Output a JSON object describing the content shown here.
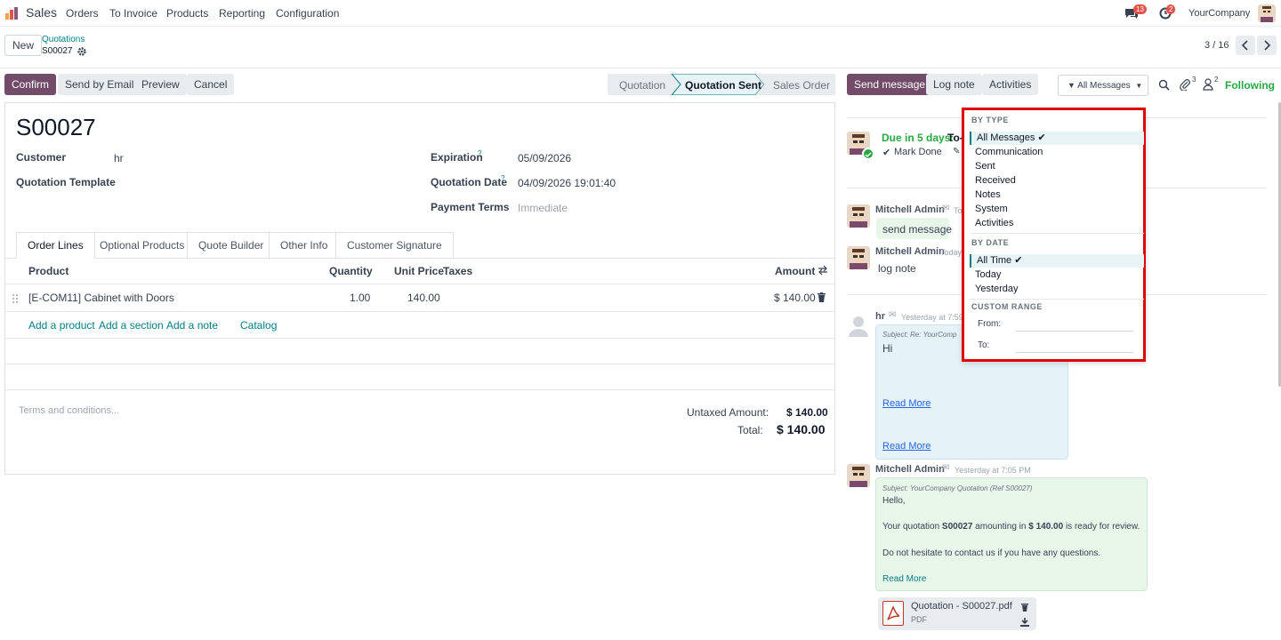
{
  "navbar": {
    "app_name": "Sales",
    "menu": [
      "Orders",
      "To Invoice",
      "Products",
      "Reporting",
      "Configuration"
    ],
    "chat_badge": "13",
    "activity_badge": "2",
    "company": "YourCompany"
  },
  "control": {
    "new_label": "New",
    "breadcrumb_parent": "Quotations",
    "record_name": "S00027",
    "pager": "3 / 16"
  },
  "actions": {
    "confirm": "Confirm",
    "send_email": "Send by Email",
    "preview": "Preview",
    "cancel": "Cancel"
  },
  "statusbar": [
    "Quotation",
    "Quotation Sent",
    "Sales Order"
  ],
  "chatter_actions": {
    "send_message": "Send message",
    "log_note": "Log note",
    "activities": "Activities",
    "filter": "All Messages",
    "attachments_count": "3",
    "followers_count": "2",
    "following": "Following"
  },
  "form": {
    "title": "S00027",
    "customer_label": "Customer",
    "customer_value": "hr",
    "template_label": "Quotation Template",
    "expiration_label": "Expiration",
    "expiration_value": "05/09/2026",
    "qdate_label": "Quotation Date",
    "qdate_value": "04/09/2026 19:01:40",
    "terms_label": "Payment Terms",
    "terms_value": "Immediate",
    "help_mark": "?"
  },
  "tabs": [
    "Order Lines",
    "Optional Products",
    "Quote Builder",
    "Other Info",
    "Customer Signature"
  ],
  "lines": {
    "headers": {
      "product": "Product",
      "quantity": "Quantity",
      "unit_price": "Unit Price",
      "taxes": "Taxes",
      "amount": "Amount"
    },
    "rows": [
      {
        "product": "[E-COM11] Cabinet with Doors",
        "quantity": "1.00",
        "unit_price": "140.00",
        "taxes": "",
        "amount": "$ 140.00"
      }
    ],
    "add_product": "Add a product",
    "add_section": "Add a section",
    "add_note": "Add a note",
    "catalog": "Catalog"
  },
  "totals": {
    "terms_placeholder": "Terms and conditions...",
    "untaxed_label": "Untaxed Amount:",
    "untaxed_value": "$ 140.00",
    "total_label": "Total:",
    "total_value": "$ 140.00"
  },
  "chatter": {
    "activity_due": "Due in 5 days:",
    "activity_type": "To-",
    "mark_done": "Mark Done",
    "msg1_author": "Mitchell Admin",
    "msg1_time": "To",
    "msg1_body": "send message",
    "msg2_author": "Mitchell Admin",
    "msg2_time": "Today",
    "msg2_body": "log note",
    "msg3_author": "hr",
    "msg3_time": "Yesterday at 7:59 P",
    "msg3_subject": "Subject: Re: YourComp",
    "msg3_body": "Hi",
    "read_more": "Read More",
    "msg4_author": "Mitchell Admin",
    "msg4_time": "Yesterday at 7:05 PM",
    "msg4_subject": "Subject: YourCompany Quotation (Ref S00027)",
    "msg4_hello": "Hello,",
    "msg4_pre": "Your quotation ",
    "msg4_ref": "S00027",
    "msg4_mid": " amounting in ",
    "msg4_amount": "$ 140.00",
    "msg4_post": " is ready for review.",
    "msg4_contact": "Do not hesitate to contact us if you have any questions.",
    "attachment_name": "Quotation - S00027.pdf",
    "attachment_type": "PDF"
  },
  "dropdown": {
    "by_type": "BY TYPE",
    "types": [
      "All Messages",
      "Communication",
      "Sent",
      "Received",
      "Notes",
      "System",
      "Activities"
    ],
    "by_date": "BY DATE",
    "dates": [
      "All Time",
      "Today",
      "Yesterday"
    ],
    "custom_range": "CUSTOM RANGE",
    "from_label": "From:",
    "to_label": "To:"
  },
  "colors": {
    "brand": "#714b67",
    "teal": "#017e84",
    "highlight": "#e00000",
    "green": "#28a745"
  }
}
